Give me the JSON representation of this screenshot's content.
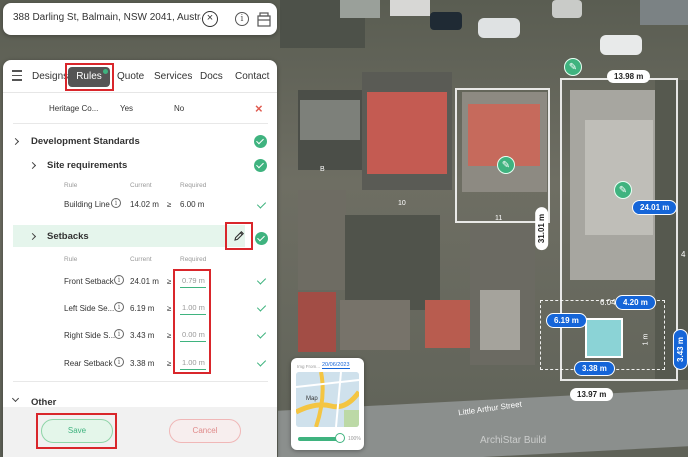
{
  "address_bar": {
    "address": "388 Darling St, Balmain, NSW 2041, Austra...",
    "clear_icon": "close-circle-icon",
    "info_icon": "info-icon",
    "layers_icon": "layers-icon"
  },
  "tabs": {
    "menu_icon": "panel-menu-icon",
    "items": [
      "Designs",
      "Rules",
      "Quote",
      "Services",
      "Docs",
      "Contact"
    ],
    "active": "Rules"
  },
  "rules": {
    "heritage_row": {
      "label": "Heritage Co...",
      "yes": "Yes",
      "no": "No"
    },
    "development_standards": {
      "title": "Development Standards",
      "site_requirements": {
        "title": "Site requirements",
        "columns": [
          "Rule",
          "Current",
          "Required"
        ],
        "rows": [
          {
            "rule": "Building Line",
            "current": "14.02 m",
            "op": "≥",
            "required": "6.00 m"
          }
        ]
      },
      "setbacks": {
        "title": "Setbacks",
        "columns": [
          "Rule",
          "Current",
          "Required"
        ],
        "rows": [
          {
            "rule": "Front Setback",
            "current": "24.01 m",
            "op": "≥",
            "required": "0.79 m"
          },
          {
            "rule": "Left Side Se...",
            "current": "6.19 m",
            "op": "≥",
            "required": "1.00 m"
          },
          {
            "rule": "Right Side S...",
            "current": "3.43 m",
            "op": "≥",
            "required": "0.00 m"
          },
          {
            "rule": "Rear Setback",
            "current": "3.38 m",
            "op": "≥",
            "required": "1.00 m"
          }
        ]
      }
    },
    "other": {
      "title": "Other"
    }
  },
  "footer": {
    "save": "Save",
    "cancel": "Cancel"
  },
  "map": {
    "lot_numbers": [
      "B",
      "10",
      "11"
    ],
    "dimensions": {
      "top": "13.98 m",
      "side": "31.01 m",
      "front": "24.01 m",
      "bottom": "13.97 m",
      "d604": "6.04",
      "d420": "4.20 m",
      "d619": "6.19 m",
      "d338": "3.38 m",
      "d343": "3.43 m",
      "d1": "1 m",
      "d4": "4"
    },
    "street": "Little Arthur Street",
    "watermark": "ArchiStar Build"
  },
  "minimap": {
    "date_label": "Img From...",
    "date": "20/06/2023",
    "label": "Map",
    "opacity": "100%"
  },
  "colors": {
    "accent": "#3fb37f",
    "highlight": "#d9262b",
    "blue_label": "#1565d8"
  }
}
